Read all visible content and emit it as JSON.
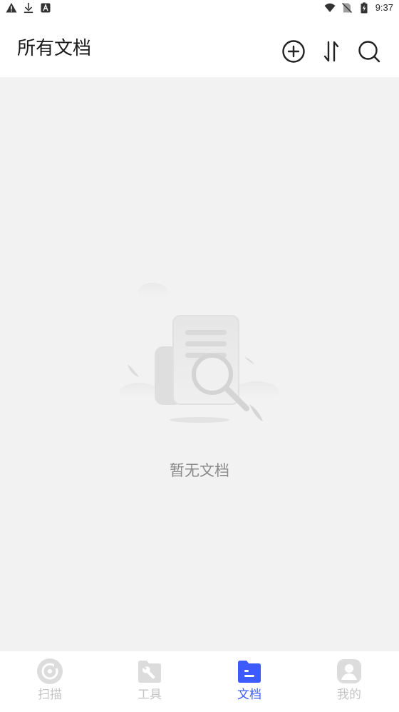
{
  "status_bar": {
    "time": "9:37",
    "left_icons": [
      "alert-icon",
      "download-icon",
      "app-notification-icon"
    ],
    "right_icons": [
      "wifi-icon",
      "no-sim-icon",
      "battery-charging-icon"
    ]
  },
  "header": {
    "title": "所有文档",
    "actions": [
      "add-circle-icon",
      "sort-icon",
      "search-icon"
    ]
  },
  "empty_state": {
    "message": "暂无文档",
    "illustration": "empty-document-search-illustration"
  },
  "bottom_nav": {
    "active_index": 2,
    "active_color": "#3d5afe",
    "inactive_color": "#c4c4c4",
    "items": [
      {
        "label": "扫描",
        "icon": "scan-icon"
      },
      {
        "label": "工具",
        "icon": "tools-icon"
      },
      {
        "label": "文档",
        "icon": "document-folder-icon"
      },
      {
        "label": "我的",
        "icon": "profile-icon"
      }
    ]
  }
}
